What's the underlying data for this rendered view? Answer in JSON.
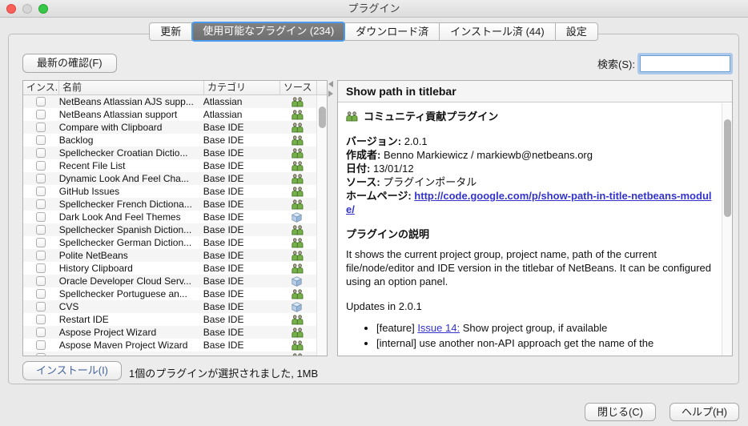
{
  "window": {
    "title": "プラグイン"
  },
  "tabs": [
    {
      "label": "更新",
      "selected": false
    },
    {
      "label": "使用可能なプラグイン (234)",
      "selected": true
    },
    {
      "label": "ダウンロード済",
      "selected": false
    },
    {
      "label": "インストール済 (44)",
      "selected": false
    },
    {
      "label": "設定",
      "selected": false
    }
  ],
  "toolbar": {
    "refresh_label": "最新の確認(F)",
    "search_label": "検索(S):",
    "search_value": ""
  },
  "table": {
    "columns": [
      "インス...",
      "名前",
      "カテゴリ",
      "ソース"
    ],
    "rows": [
      {
        "name": "NetBeans Atlassian AJS supp...",
        "category": "Atlassian",
        "source": "community"
      },
      {
        "name": "NetBeans Atlassian support",
        "category": "Atlassian",
        "source": "community"
      },
      {
        "name": "Compare with Clipboard",
        "category": "Base IDE",
        "source": "community"
      },
      {
        "name": "Backlog",
        "category": "Base IDE",
        "source": "community"
      },
      {
        "name": "Spellchecker Croatian Dictio...",
        "category": "Base IDE",
        "source": "community"
      },
      {
        "name": "Recent File List",
        "category": "Base IDE",
        "source": "community"
      },
      {
        "name": "Dynamic Look And Feel Cha...",
        "category": "Base IDE",
        "source": "community"
      },
      {
        "name": "GitHub Issues",
        "category": "Base IDE",
        "source": "community"
      },
      {
        "name": "Spellchecker French Dictiona...",
        "category": "Base IDE",
        "source": "community"
      },
      {
        "name": "Dark Look And Feel Themes",
        "category": "Base IDE",
        "source": "portal"
      },
      {
        "name": "Spellchecker Spanish Diction...",
        "category": "Base IDE",
        "source": "community"
      },
      {
        "name": "Spellchecker German Diction...",
        "category": "Base IDE",
        "source": "community"
      },
      {
        "name": "Polite NetBeans",
        "category": "Base IDE",
        "source": "community"
      },
      {
        "name": "History Clipboard",
        "category": "Base IDE",
        "source": "community"
      },
      {
        "name": "Oracle Developer Cloud Serv...",
        "category": "Base IDE",
        "source": "portal"
      },
      {
        "name": "Spellchecker Portuguese an...",
        "category": "Base IDE",
        "source": "community"
      },
      {
        "name": "CVS",
        "category": "Base IDE",
        "source": "portal"
      },
      {
        "name": "Restart IDE",
        "category": "Base IDE",
        "source": "community"
      },
      {
        "name": "Aspose Project Wizard",
        "category": "Base IDE",
        "source": "community"
      },
      {
        "name": "Aspose Maven Project Wizard",
        "category": "Base IDE",
        "source": "community"
      },
      {
        "name": "",
        "category": "",
        "source": "community"
      }
    ]
  },
  "details": {
    "title": "Show path in titlebar",
    "badge_label": "コミュニティ貢献プラグイン",
    "badge_icon": "community-users-icon",
    "meta": [
      {
        "label": "バージョン:",
        "value": "2.0.1"
      },
      {
        "label": "作成者:",
        "value": "Benno Markiewicz / markiewb@netbeans.org"
      },
      {
        "label": "日付:",
        "value": "13/01/12"
      },
      {
        "label": "ソース:",
        "value": "プラグインポータル"
      },
      {
        "label": "ホームページ:",
        "value": "http://code.google.com/p/show-path-in-title-netbeans-module/",
        "link": true
      }
    ],
    "description_heading": "プラグインの説明",
    "description": "It shows the current project group, project name, path of the current file/node/editor and IDE version in the titlebar of NetBeans. It can be configured using an option panel.",
    "updates": {
      "title": "Updates in 2.0.1",
      "items": [
        {
          "prefix": "[feature] ",
          "link": "Issue 14:",
          "suffix": " Show project group, if available"
        },
        {
          "prefix": "[internal] use another non-API approach get the name of the",
          "link": "",
          "suffix": ""
        }
      ]
    }
  },
  "footer": {
    "install_label": "インストール(I)",
    "status": "1個のプラグインが選択されました, 1MB"
  },
  "dialog": {
    "close": "閉じる(C)",
    "help": "ヘルプ(H)"
  },
  "colors": {
    "tab_selected_ring": "#4a9bf0",
    "tab_selected_bg": "#747474",
    "link": "#3333cc",
    "install_text": "#44639c",
    "community_icon_green": "#76b049",
    "portal_icon_blue": "#b7cfe8"
  }
}
